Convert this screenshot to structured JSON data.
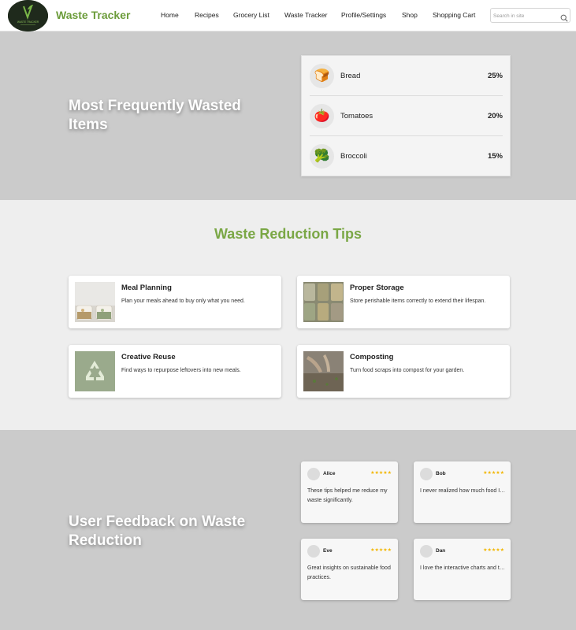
{
  "header": {
    "logo_text": "WASTE TRACKER",
    "brand": "Waste Tracker",
    "nav": [
      "Home",
      "Recipes",
      "Grocery List",
      "Waste Tracker",
      "Profile/Settings",
      "Shop",
      "Shopping Cart"
    ],
    "search_placeholder": "Search in site",
    "search_icon": "search-icon"
  },
  "wasted": {
    "title": "Most Frequently Wasted Items",
    "items": [
      {
        "name": "Bread",
        "percent": "25%",
        "icon": "🍞"
      },
      {
        "name": "Tomatoes",
        "percent": "20%",
        "icon": "🍅"
      },
      {
        "name": "Broccoli",
        "percent": "15%",
        "icon": "🥦"
      }
    ]
  },
  "tips": {
    "heading": "Waste Reduction Tips",
    "items": [
      {
        "title": "Meal Planning",
        "desc": "Plan your meals ahead to buy only what you need."
      },
      {
        "title": "Proper Storage",
        "desc": "Store perishable items correctly to extend their lifespan."
      },
      {
        "title": "Creative Reuse",
        "desc": "Find ways to repurpose leftovers into new meals."
      },
      {
        "title": "Composting",
        "desc": "Turn food scraps into compost for your garden."
      }
    ]
  },
  "feedback": {
    "title": "User Feedback on Waste Reduction",
    "stars": "★★★★★",
    "rating": 5,
    "star_color": "#f2b600",
    "items": [
      {
        "name": "Alice",
        "text": "These tips helped me reduce my waste significantly."
      },
      {
        "name": "Bob",
        "text": "I never realized how much food I was wasting."
      },
      {
        "name": "Eve",
        "text": "Great insights on sustainable food practices."
      },
      {
        "name": "Dan",
        "text": "I love the interactive charts and tracking."
      }
    ]
  },
  "colors": {
    "brand": "#6c9c3b",
    "tips_heading": "#7aa745",
    "section_gray": "#cbcbcb",
    "section_light": "#eeeeee"
  }
}
